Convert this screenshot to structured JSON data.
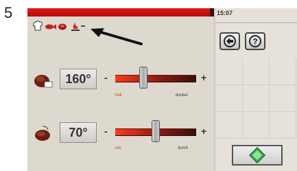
{
  "step_number": "5",
  "header": {
    "time": "15:07"
  },
  "nav": {
    "back_icon": "back-arrow-icon",
    "help_label": "?"
  },
  "product_icons": [
    "chef-hat-icon",
    "fish-icon",
    "meat-icon",
    "fire-icon"
  ],
  "annotation_icon": "pointer-arrow-icon",
  "settings": [
    {
      "icon": "meat-roast-icon",
      "temperature": "160°",
      "minus": "-",
      "plus": "+",
      "label_left": "hell",
      "label_right": "dunkel",
      "level": 0.35
    },
    {
      "icon": "meat-core-temp-icon",
      "temperature": "70°",
      "minus": "-",
      "plus": "+",
      "label_left": "roh",
      "label_right": "durch",
      "level": 0.5
    }
  ],
  "start_button_icon": "start-diamond-icon",
  "colors": {
    "accent_red": "#d21010",
    "slider_dark": "#3a1008",
    "start_green": "#3cb44a",
    "panel_bg": "#ddd9cf"
  }
}
